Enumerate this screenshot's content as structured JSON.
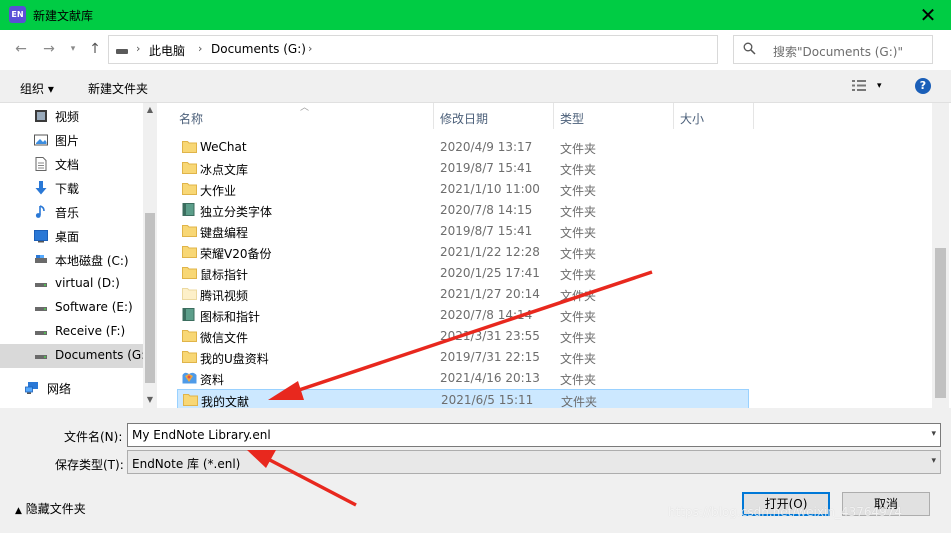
{
  "window": {
    "title": "新建文献库",
    "app_icon_text": "EN",
    "close_icon": "close-icon"
  },
  "nav": {
    "back_icon": "back-arrow-icon",
    "forward_icon": "forward-arrow-icon",
    "recent_icon": "chevron-down-icon",
    "up_icon": "up-arrow-icon",
    "breadcrumb": [
      "此电脑",
      "Documents (G:)"
    ],
    "refresh_icon": "refresh-icon",
    "search_placeholder": "搜索\"Documents (G:)\""
  },
  "toolbar": {
    "organize_label": "组织 ▾",
    "new_folder_label": "新建文件夹",
    "view_icon": "view-options-icon",
    "help_label": "?"
  },
  "sidebar": {
    "items": [
      {
        "label": "视频",
        "icon": "video-icon"
      },
      {
        "label": "图片",
        "icon": "pictures-icon"
      },
      {
        "label": "文档",
        "icon": "documents-icon"
      },
      {
        "label": "下载",
        "icon": "download-icon"
      },
      {
        "label": "音乐",
        "icon": "music-icon"
      },
      {
        "label": "桌面",
        "icon": "desktop-icon"
      },
      {
        "label": "本地磁盘 (C:)",
        "icon": "drive-icon"
      },
      {
        "label": "virtual (D:)",
        "icon": "drive-icon"
      },
      {
        "label": "Software (E:)",
        "icon": "drive-icon"
      },
      {
        "label": "Receive (F:)",
        "icon": "drive-icon"
      },
      {
        "label": "Documents (G:)",
        "icon": "drive-icon",
        "selected": true
      },
      {
        "label": "网络",
        "icon": "network-icon"
      }
    ]
  },
  "files": {
    "columns": [
      "名称",
      "修改日期",
      "类型",
      "大小"
    ],
    "rows": [
      {
        "name": "WeChat",
        "date": "2020/4/9 13:17",
        "type": "文件夹",
        "icon": "folder-icon"
      },
      {
        "name": "冰点文库",
        "date": "2019/8/7 15:41",
        "type": "文件夹",
        "icon": "folder-icon"
      },
      {
        "name": "大作业",
        "date": "2021/1/10 11:00",
        "type": "文件夹",
        "icon": "folder-icon"
      },
      {
        "name": "独立分类字体",
        "date": "2020/7/8 14:15",
        "type": "文件夹",
        "icon": "book-folder-icon"
      },
      {
        "name": "键盘编程",
        "date": "2019/8/7 15:41",
        "type": "文件夹",
        "icon": "folder-icon"
      },
      {
        "name": "荣耀V20备份",
        "date": "2021/1/22 12:28",
        "type": "文件夹",
        "icon": "folder-icon"
      },
      {
        "name": "鼠标指针",
        "date": "2020/1/25 17:41",
        "type": "文件夹",
        "icon": "folder-icon"
      },
      {
        "name": "腾讯视频",
        "date": "2021/1/27 20:14",
        "type": "文件夹",
        "icon": "folder-light-icon"
      },
      {
        "name": "图标和指针",
        "date": "2020/7/8 14:14",
        "type": "文件夹",
        "icon": "book-folder-icon"
      },
      {
        "name": "微信文件",
        "date": "2021/3/31 23:55",
        "type": "文件夹",
        "icon": "folder-icon"
      },
      {
        "name": "我的U盘资料",
        "date": "2019/7/31 22:15",
        "type": "文件夹",
        "icon": "folder-icon"
      },
      {
        "name": "资料",
        "date": "2021/4/16 20:13",
        "type": "文件夹",
        "icon": "colorful-folder-icon"
      },
      {
        "name": "我的文献",
        "date": "2021/6/5 15:11",
        "type": "文件夹",
        "icon": "folder-icon",
        "selected": true
      }
    ]
  },
  "form": {
    "filename_label": "文件名(N):",
    "filename_value": "My EndNote Library.enl",
    "filetype_label": "保存类型(T):",
    "filetype_value": "EndNote 库 (*.enl)",
    "hide_folders_label": "隐藏文件夹",
    "open_button": "打开(O)",
    "cancel_button": "取消"
  },
  "watermark": "https://blog.csdn.net/weixin_43764974",
  "colors": {
    "titlebar": "#00cc44",
    "selection": "#cce8ff",
    "annotation_arrow": "#e8281e",
    "folder": "#f8d775"
  }
}
